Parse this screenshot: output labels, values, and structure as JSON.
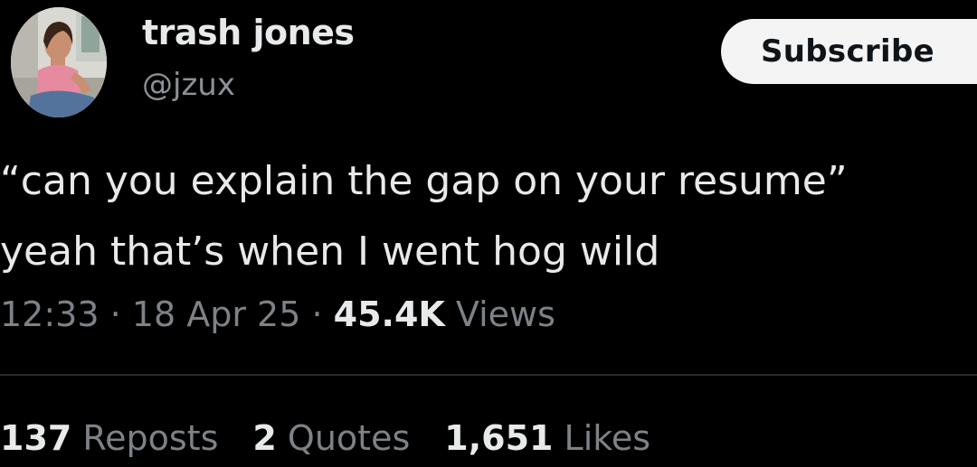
{
  "author": {
    "display_name": "trash jones",
    "handle": "@jzux"
  },
  "subscribe_label": "Subscribe",
  "tweet": {
    "lines": [
      "“can you explain the gap on your resume”",
      "yeah that’s when I went hog wild"
    ]
  },
  "meta": {
    "time": "12:33",
    "separator": " · ",
    "date": "18 Apr 25",
    "views_count": "45.4K",
    "views_label": "Views"
  },
  "stats": {
    "reposts_count": "137",
    "reposts_label": "Reposts",
    "quotes_count": "2",
    "quotes_label": "Quotes",
    "likes_count": "1,651",
    "likes_label": "Likes"
  },
  "colors": {
    "background": "#000000",
    "primary_text": "#e7e9ea",
    "secondary_text": "#7d8287",
    "button_bg": "#f4f4f4",
    "divider": "#2a2d30"
  }
}
